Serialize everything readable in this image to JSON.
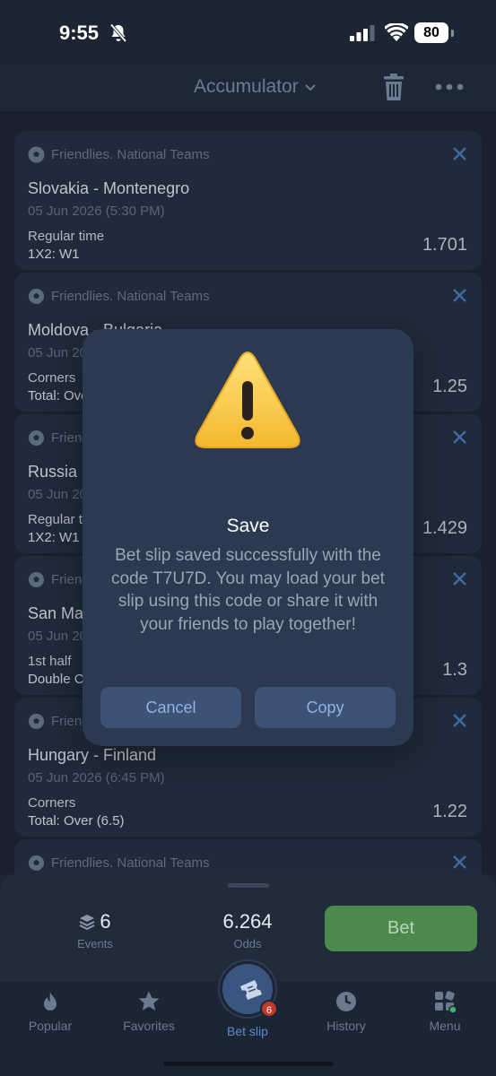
{
  "status_bar": {
    "time": "9:55",
    "battery": "80"
  },
  "header": {
    "title": "Accumulator"
  },
  "bets": [
    {
      "league": "Friendlies. National Teams",
      "teams": "Slovakia - Montenegro",
      "date": "05 Jun 2026 (5:30 PM)",
      "market": "Regular time",
      "pick": "1X2: W1",
      "odds": "1.701"
    },
    {
      "league": "Friendlies. National Teams",
      "teams": "Moldova - Bulgaria",
      "date": "05 Jun 2026",
      "market": "Corners",
      "pick": "Total: Over",
      "odds": "1.25"
    },
    {
      "league": "Friendlies. National Teams",
      "teams": "Russia",
      "date": "05 Jun 2026",
      "market": "Regular time",
      "pick": "1X2: W1",
      "odds": "1.429"
    },
    {
      "league": "Friendlies. National Teams",
      "teams": "San Marino",
      "date": "05 Jun 2026",
      "market": "1st half",
      "pick": "Double Chance",
      "odds": "1.3"
    },
    {
      "league": "Friendlies. National Teams",
      "teams": "Hungary - Finland",
      "date": "05 Jun 2026 (6:45 PM)",
      "market": "Corners",
      "pick": "Total: Over (6.5)",
      "odds": "1.22"
    },
    {
      "league": "Friendlies. National Teams"
    }
  ],
  "modal": {
    "title": "Save",
    "message": "Bet slip saved successfully with the code T7U7D. You may load your bet slip using this code or share it with your friends to play together!",
    "cancel_label": "Cancel",
    "copy_label": "Copy"
  },
  "summary": {
    "events_count": "6",
    "events_label": "Events",
    "odds_value": "6.264",
    "odds_label": "Odds",
    "bet_label": "Bet"
  },
  "tabs": {
    "popular": "Popular",
    "favorites": "Favorites",
    "betslip": "Bet slip",
    "betslip_badge": "6",
    "history": "History",
    "menu": "Menu"
  },
  "colors": {
    "accent": "#5b8cd0",
    "bet_green": "#4b8a4c",
    "close_blue": "#4d7fc4"
  }
}
